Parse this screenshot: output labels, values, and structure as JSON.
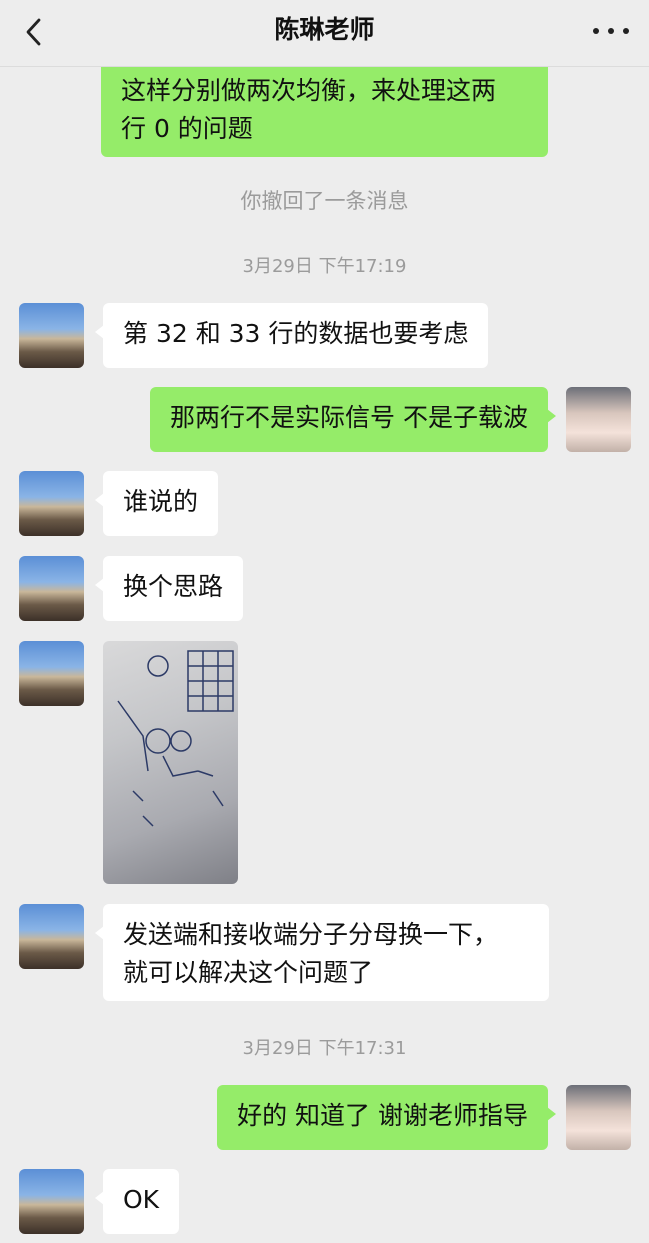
{
  "header": {
    "title": "陈琳老师",
    "back_icon": "chevron-left-icon",
    "more_icon": "more-dots-icon"
  },
  "messages": [
    {
      "side": "right",
      "type": "text",
      "lines": [
        "这样分别做两次均衡，来处理这两",
        "行 0 的问题"
      ]
    },
    {
      "side": "system",
      "type": "recall",
      "text": "你撤回了一条消息"
    },
    {
      "side": "system",
      "type": "time",
      "text": "3月29日 下午17:19"
    },
    {
      "side": "left",
      "type": "text",
      "text": "第 32 和 33 行的数据也要考虑"
    },
    {
      "side": "right",
      "type": "text",
      "text": "那两行不是实际信号 不是子载波"
    },
    {
      "side": "left",
      "type": "text",
      "text": "谁说的"
    },
    {
      "side": "left",
      "type": "text",
      "text": "换个思路"
    },
    {
      "side": "left",
      "type": "image"
    },
    {
      "side": "left",
      "type": "text",
      "lines": [
        "发送端和接收端分子分母换一下，",
        "就可以解决这个问题了"
      ]
    },
    {
      "side": "system",
      "type": "time",
      "text": "3月29日 下午17:31"
    },
    {
      "side": "right",
      "type": "text",
      "text": "好的 知道了 谢谢老师指导"
    },
    {
      "side": "left",
      "type": "text",
      "text": "OK"
    }
  ]
}
